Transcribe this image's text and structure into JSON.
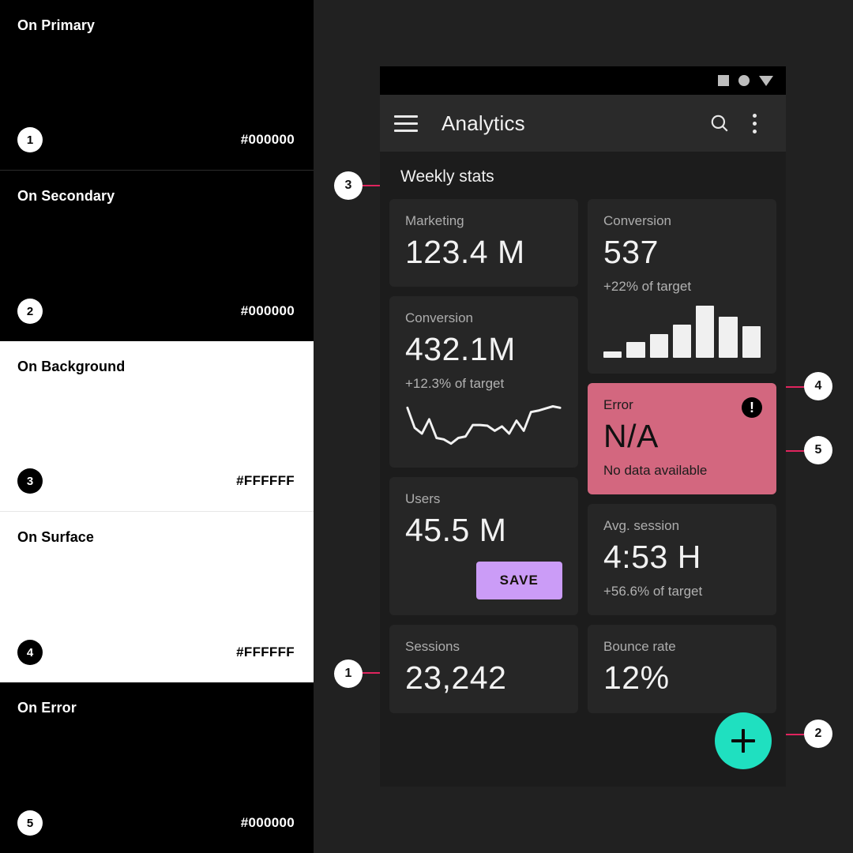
{
  "swatches": [
    {
      "name": "On Primary",
      "hex": "#000000",
      "marker": "1"
    },
    {
      "name": "On Secondary",
      "hex": "#000000",
      "marker": "2"
    },
    {
      "name": "On Background",
      "hex": "#FFFFFF",
      "marker": "3"
    },
    {
      "name": "On Surface",
      "hex": "#FFFFFF",
      "marker": "4"
    },
    {
      "name": "On Error",
      "hex": "#000000",
      "marker": "5"
    }
  ],
  "callouts": [
    {
      "number": "1",
      "target": "save-button"
    },
    {
      "number": "2",
      "target": "fab-add-button"
    },
    {
      "number": "3",
      "target": "section-title"
    },
    {
      "number": "4",
      "target": "bar-chart"
    },
    {
      "number": "5",
      "target": "error-icon"
    }
  ],
  "phone": {
    "statusbar": {
      "icons": [
        "square-icon",
        "circle-icon",
        "triangle-down-icon"
      ]
    },
    "appbar": {
      "menu_icon": "hamburger-menu-icon",
      "title": "Analytics",
      "search_icon": "search-icon",
      "overflow_icon": "more-vert-icon"
    },
    "section_title": "Weekly stats",
    "cards": {
      "marketing": {
        "label": "Marketing",
        "value": "123.4 M"
      },
      "conversion_l": {
        "label": "Conversion",
        "value": "432.1M",
        "sub": "+12.3% of target"
      },
      "users": {
        "label": "Users",
        "value": "45.5 M",
        "save_label": "SAVE"
      },
      "sessions": {
        "label": "Sessions",
        "value": "23,242"
      },
      "conversion_r": {
        "label": "Conversion",
        "value": "537",
        "sub": "+22% of target"
      },
      "error": {
        "label": "Error",
        "value": "N/A",
        "sub": "No data available",
        "icon": "!"
      },
      "avg_session": {
        "label": "Avg. session",
        "value": "4:53 H",
        "sub": "+56.6% of target"
      },
      "bounce": {
        "label": "Bounce rate",
        "value": "12%"
      }
    },
    "fab": {
      "icon": "plus-icon"
    }
  },
  "chart_data": [
    {
      "type": "bar",
      "title": "Conversion",
      "categories": [
        "1",
        "2",
        "3",
        "4",
        "5",
        "6",
        "7"
      ],
      "values": [
        8,
        20,
        30,
        42,
        66,
        52,
        40
      ],
      "ylim": [
        0,
        68
      ],
      "xlabel": "",
      "ylabel": "",
      "grid": false,
      "legend": "none"
    },
    {
      "type": "line",
      "title": "Conversion",
      "x": [
        0,
        1,
        2,
        3,
        4,
        5,
        6,
        7,
        8,
        9,
        10,
        11,
        12,
        13,
        14,
        15,
        16,
        17,
        18,
        19,
        20,
        21
      ],
      "values": [
        58,
        30,
        22,
        42,
        16,
        14,
        8,
        16,
        18,
        34,
        34,
        33,
        26,
        32,
        22,
        40,
        26,
        52,
        54,
        57,
        60,
        58
      ],
      "ylim": [
        0,
        66
      ],
      "xlabel": "",
      "ylabel": "",
      "grid": false,
      "legend": "none"
    }
  ],
  "colors": {
    "accent_callout": "#E0245E",
    "error_card": "#D3677F",
    "save_button": "#CB9CF7",
    "fab": "#1FE0C0",
    "app_background": "#1C1C1C",
    "card_surface": "#262626",
    "page_background": "#212121"
  }
}
